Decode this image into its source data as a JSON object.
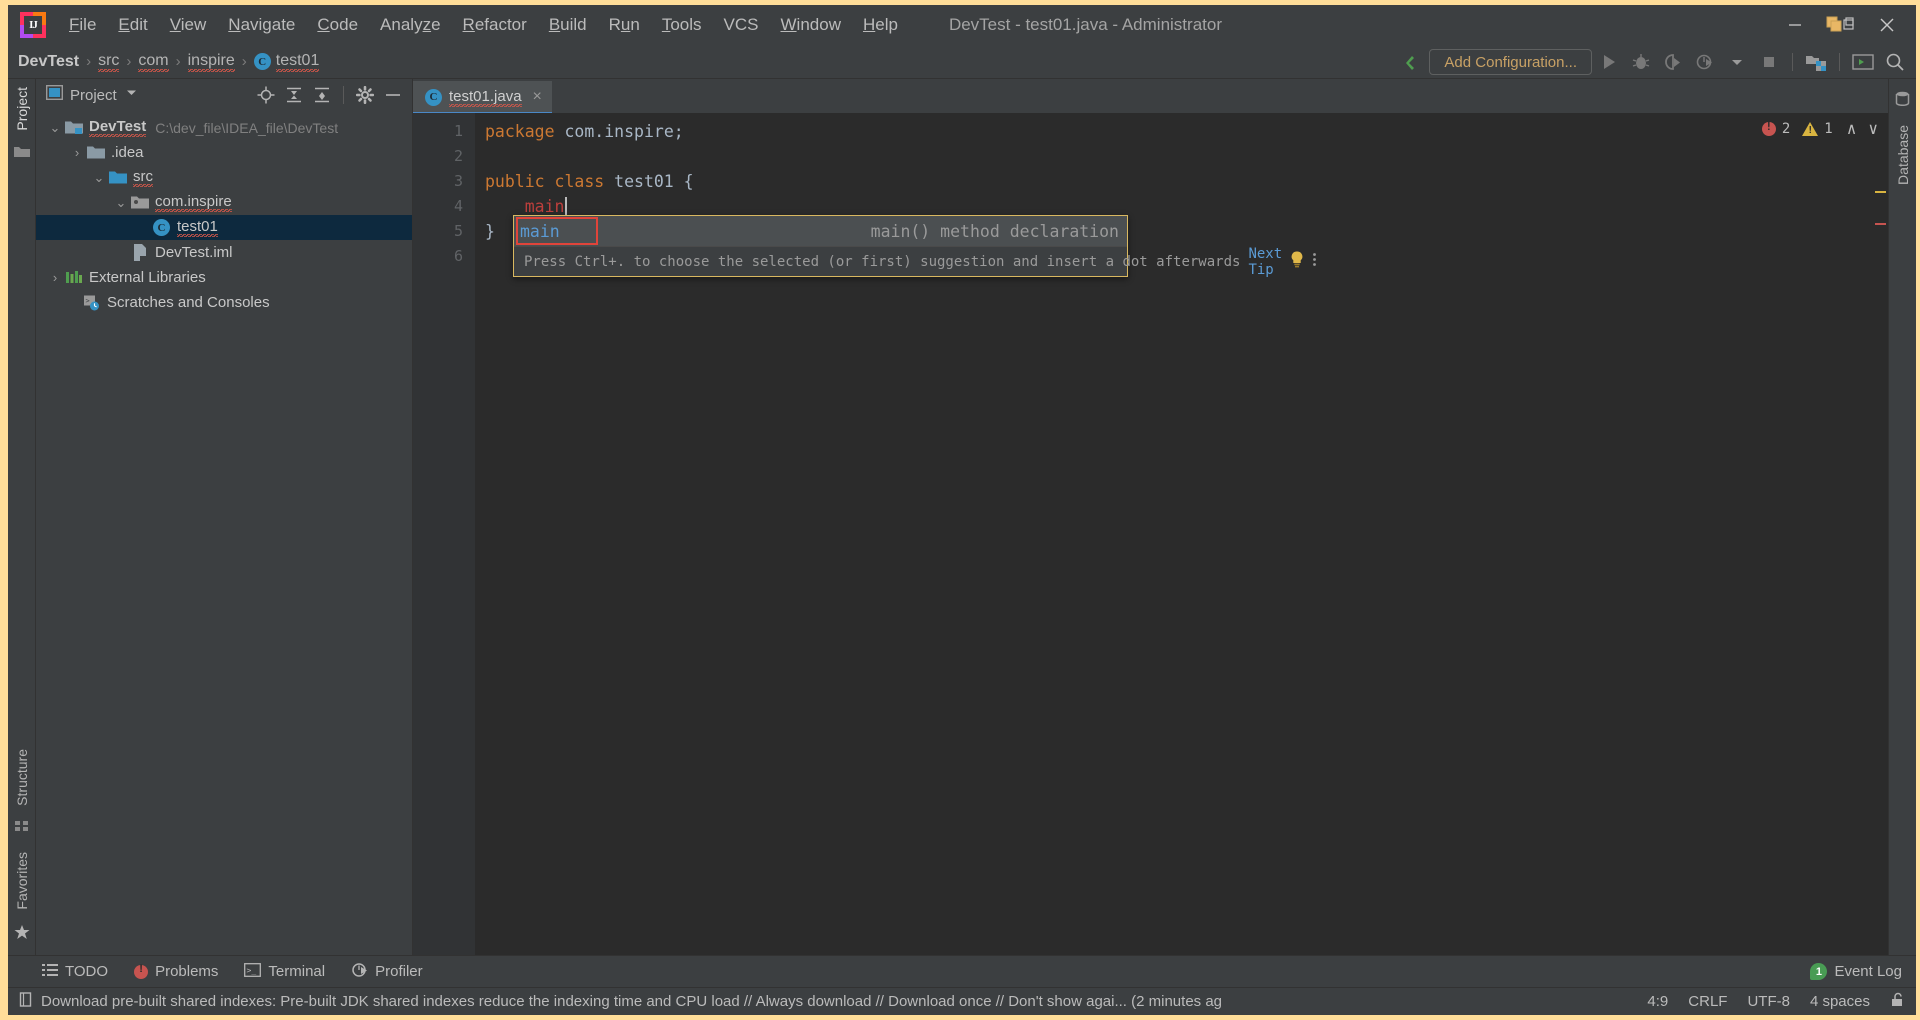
{
  "window": {
    "title": "DevTest - test01.java - Administrator",
    "logo_text": "IJ",
    "controls": {
      "minimize": "minimize-window",
      "restore": "restore-window",
      "close": "close-window"
    }
  },
  "menubar": {
    "items": [
      {
        "label": "File",
        "mnemonic": "F"
      },
      {
        "label": "Edit",
        "mnemonic": "E"
      },
      {
        "label": "View",
        "mnemonic": "V"
      },
      {
        "label": "Navigate",
        "mnemonic": "N"
      },
      {
        "label": "Code",
        "mnemonic": "C"
      },
      {
        "label": "Analyze",
        "mnemonic": "z"
      },
      {
        "label": "Refactor",
        "mnemonic": "R"
      },
      {
        "label": "Build",
        "mnemonic": "B"
      },
      {
        "label": "Run",
        "mnemonic": "u"
      },
      {
        "label": "Tools",
        "mnemonic": "T"
      },
      {
        "label": "VCS",
        "mnemonic": ""
      },
      {
        "label": "Window",
        "mnemonic": "W"
      },
      {
        "label": "Help",
        "mnemonic": "H"
      }
    ]
  },
  "toolbar": {
    "breadcrumb": [
      {
        "label": "DevTest",
        "bold": true,
        "squiggle": false,
        "icon": ""
      },
      {
        "label": "src",
        "bold": false,
        "squiggle": true,
        "icon": ""
      },
      {
        "label": "com",
        "bold": false,
        "squiggle": true,
        "icon": ""
      },
      {
        "label": "inspire",
        "bold": false,
        "squiggle": true,
        "icon": ""
      },
      {
        "label": "test01",
        "bold": false,
        "squiggle": true,
        "icon": "class-badge"
      }
    ],
    "separator": "›",
    "add_configuration_label": "Add Configuration...",
    "icons": [
      "make-project-icon",
      "run-icon",
      "debug-icon",
      "run-with-coverage-icon",
      "profiler-icon",
      "dropdown-icon",
      "stop-icon",
      "project-structure-icon",
      "terminal-icon",
      "search-everywhere-icon"
    ]
  },
  "left_strip": {
    "tabs": [
      "Project",
      "Structure",
      "Favorites"
    ],
    "active": "Project"
  },
  "right_strip": {
    "tabs": [
      "Database"
    ]
  },
  "project_panel": {
    "title": "Project",
    "actions": [
      "locate-icon",
      "expand-all-icon",
      "collapse-all-icon",
      "settings-gear-icon",
      "hide-icon"
    ],
    "tree": [
      {
        "depth": 0,
        "chevron": "down",
        "icon": "module-folder-icon",
        "label": "DevTest",
        "bold": true,
        "squiggle": true,
        "path": "C:\\dev_file\\IDEA_file\\DevTest",
        "selected": false
      },
      {
        "depth": 1,
        "chevron": "right",
        "icon": "folder-icon",
        "label": ".idea",
        "bold": false,
        "squiggle": false,
        "path": "",
        "selected": false
      },
      {
        "depth": 1,
        "chevron": "down",
        "icon": "source-folder-icon",
        "label": "src",
        "bold": false,
        "squiggle": true,
        "path": "",
        "selected": false
      },
      {
        "depth": 2,
        "chevron": "down",
        "icon": "package-icon",
        "label": "com.inspire",
        "bold": false,
        "squiggle": true,
        "path": "",
        "selected": false
      },
      {
        "depth": 3,
        "chevron": "none",
        "icon": "class-badge",
        "label": "test01",
        "bold": false,
        "squiggle": true,
        "path": "",
        "selected": true
      },
      {
        "depth": 2,
        "chevron": "none",
        "icon": "iml-file-icon",
        "label": "DevTest.iml",
        "bold": false,
        "squiggle": false,
        "path": "",
        "selected": false
      },
      {
        "depth": 0,
        "chevron": "right",
        "icon": "libraries-icon",
        "label": "External Libraries",
        "bold": false,
        "squiggle": false,
        "path": "",
        "selected": false
      },
      {
        "depth": 0,
        "chevron": "none",
        "icon": "scratches-icon",
        "label": "Scratches and Consoles",
        "bold": false,
        "squiggle": false,
        "path": "",
        "selected": false
      }
    ]
  },
  "editor": {
    "tab": {
      "label": "test01.java",
      "icon": "class-badge",
      "close": "×",
      "squiggle": true
    },
    "gutter_lines": [
      "1",
      "2",
      "3",
      "4",
      "5",
      "6"
    ],
    "code_lines": [
      {
        "n": 1,
        "tokens": [
          {
            "t": "package ",
            "c": "kw"
          },
          {
            "t": "com.inspire;",
            "c": "pkg"
          }
        ]
      },
      {
        "n": 2,
        "tokens": []
      },
      {
        "n": 3,
        "tokens": [
          {
            "t": "public class ",
            "c": "kw"
          },
          {
            "t": "test01 {",
            "c": "cls"
          }
        ]
      },
      {
        "n": 4,
        "tokens": [
          {
            "t": "    ",
            "c": "plain"
          },
          {
            "t": "main",
            "c": "err"
          }
        ]
      },
      {
        "n": 5,
        "tokens": [
          {
            "t": "}",
            "c": "plain"
          }
        ]
      },
      {
        "n": 6,
        "tokens": []
      }
    ],
    "inspection": {
      "error_count": "2",
      "warning_count": "1",
      "up": "∧",
      "down": "∨"
    }
  },
  "completion_popup": {
    "item_text": "main",
    "item_type": "main() method declaration",
    "tip_text": "Press Ctrl+. to choose the selected (or first) suggestion and insert a dot afterwards",
    "next_tip_label": "Next Tip",
    "bulb_icon": "lightbulb-icon",
    "more_icon": "more-options-icon"
  },
  "bottom_bar": {
    "windows": [
      {
        "label": "TODO",
        "icon": "todo-icon"
      },
      {
        "label": "Problems",
        "icon": "problems-icon"
      },
      {
        "label": "Terminal",
        "icon": "terminal-icon"
      },
      {
        "label": "Profiler",
        "icon": "profiler-icon"
      }
    ],
    "event_log": {
      "label": "Event Log",
      "count": "1"
    }
  },
  "status_bar": {
    "icon": "notification-icon",
    "message": "Download pre-built shared indexes: Pre-built JDK shared indexes reduce the indexing time and CPU load // Always download // Download once // Don't show agai... (2 minutes aɡ",
    "caret_position": "4:9",
    "line_separator": "CRLF",
    "encoding": "UTF-8",
    "indent": "4 spaces",
    "lock_icon": "unlocked-icon"
  }
}
